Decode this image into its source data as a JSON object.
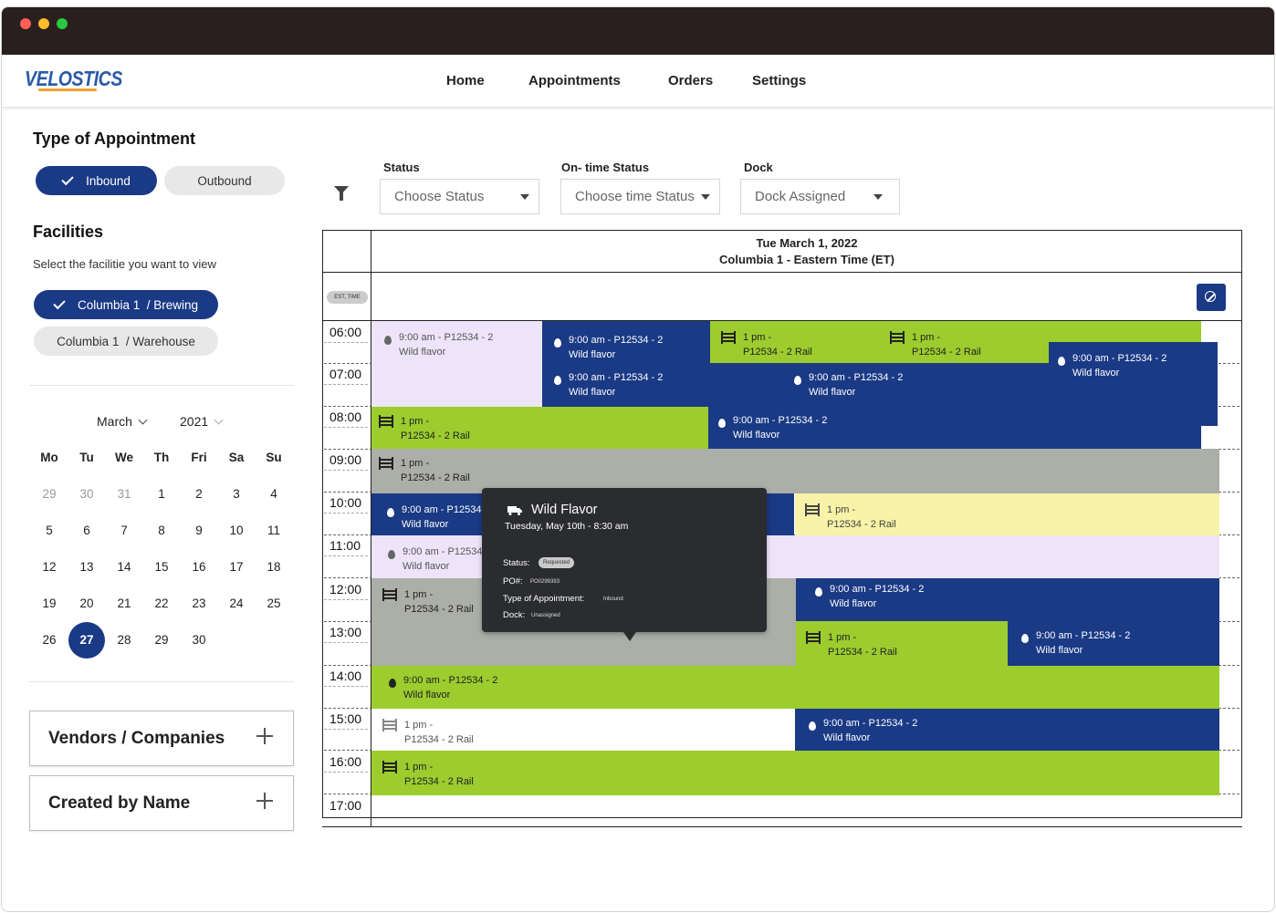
{
  "header": {
    "logo": "VELOSTICS",
    "nav": [
      "Home",
      "Appointments",
      "Orders",
      "Settings"
    ]
  },
  "sidebar": {
    "type_heading": "Type of Appointment",
    "type_options": [
      {
        "label": "Inbound",
        "selected": true
      },
      {
        "label": "Outbound",
        "selected": false
      }
    ],
    "facilities_heading": "Facilities",
    "facilities_sub": "Select the facilitie you want to view",
    "facilities": [
      {
        "label": "Columbia 1  / Brewing",
        "selected": true
      },
      {
        "label": "Columbia 1  / Warehouse",
        "selected": false
      }
    ],
    "calendar": {
      "month": "March",
      "year": "2021",
      "dow": [
        "Mo",
        "Tu",
        "We",
        "Th",
        "Fri",
        "Sa",
        "Su"
      ],
      "weeks": [
        [
          "29",
          "30",
          "31",
          "1",
          "2",
          "3",
          "4"
        ],
        [
          "5",
          "6",
          "7",
          "8",
          "9",
          "10",
          "11"
        ],
        [
          "12",
          "13",
          "14",
          "15",
          "16",
          "17",
          "18"
        ],
        [
          "19",
          "20",
          "21",
          "22",
          "23",
          "24",
          "25"
        ],
        [
          "26",
          "27",
          "28",
          "29",
          "30",
          "",
          ""
        ]
      ],
      "selected": "27"
    },
    "accordions": [
      "Vendors / Companies",
      "Created by Name"
    ]
  },
  "filters": {
    "status": {
      "label": "Status",
      "placeholder": "Choose Status"
    },
    "ontime": {
      "label": "On- time Status",
      "placeholder": "Choose time Status"
    },
    "dock": {
      "label": "Dock",
      "placeholder": "Dock Assigned"
    }
  },
  "schedule": {
    "date": "Tue March 1, 2022",
    "facility": "Columbia 1 - Eastern Time (ET)",
    "tz_badge": "EST, TIME",
    "times": [
      "06:00",
      "07:00",
      "08:00",
      "09:00",
      "10:00",
      "11:00",
      "12:00",
      "13:00",
      "14:00",
      "15:00",
      "16:00",
      "17:00"
    ],
    "events": [
      {
        "l1": "9:00 am - P12534 - 2",
        "l2": "Wild flavor"
      },
      {
        "l1": "1 pm -",
        "l2": "P12534 - 2 Rail"
      }
    ]
  },
  "tooltip": {
    "title": "Wild Flavor",
    "datetime": "Tuesday, May 10th - 8:30 am",
    "status_label": "Status:",
    "status_value": "Requested",
    "po_label": "PO#:",
    "po_value": "PO0299393",
    "type_label": "Type of Appointment:",
    "type_value": "Inbound",
    "dock_label": "Dock:",
    "dock_value": "Unassigned"
  },
  "colors": {
    "brand_blue": "#1b3a85",
    "green": "#9ccc2e",
    "lavender": "#ede4fa",
    "gray": "#acaea8",
    "yellow": "#f8f3a8",
    "logo_accent": "#f0a030"
  }
}
